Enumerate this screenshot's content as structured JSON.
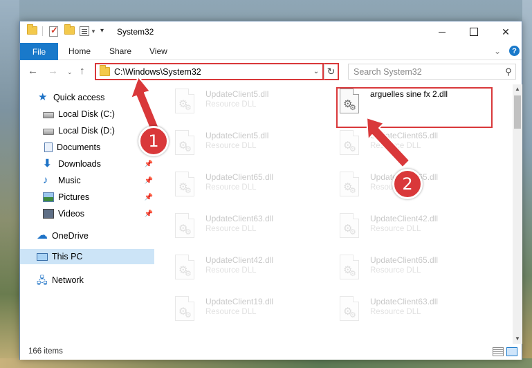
{
  "window": {
    "title": "System32",
    "close_glyph": "✕"
  },
  "ribbon": {
    "tabs": [
      "File",
      "Home",
      "Share",
      "View"
    ],
    "help_glyph": "?"
  },
  "address": {
    "path": "C:\\Windows\\System32",
    "search_placeholder": "Search System32"
  },
  "nav": {
    "items": [
      {
        "label": "Quick access",
        "icon": "star-icon",
        "pinned": false
      },
      {
        "label": "Local Disk (C:)",
        "icon": "disk-icon",
        "pinned": true
      },
      {
        "label": "Local Disk (D:)",
        "icon": "disk-icon",
        "pinned": true
      },
      {
        "label": "Documents",
        "icon": "documents-icon",
        "pinned": true
      },
      {
        "label": "Downloads",
        "icon": "download-icon",
        "pinned": true
      },
      {
        "label": "Music",
        "icon": "music-icon",
        "pinned": true
      },
      {
        "label": "Pictures",
        "icon": "pictures-icon",
        "pinned": true
      },
      {
        "label": "Videos",
        "icon": "videos-icon",
        "pinned": true
      },
      {
        "label": "OneDrive",
        "icon": "cloud-icon",
        "pinned": false
      },
      {
        "label": "This PC",
        "icon": "pc-icon",
        "pinned": false,
        "selected": true
      },
      {
        "label": "Network",
        "icon": "network-icon",
        "pinned": false
      }
    ]
  },
  "files": {
    "highlighted": {
      "name": "arguelles sine fx 2.dll"
    },
    "left_column": [
      {
        "name": "UpdateClient5.dll",
        "type": "Resource DLL"
      },
      {
        "name": "UpdateClient5.dll",
        "type": "Resource DLL"
      },
      {
        "name": "UpdateClient65.dll",
        "type": "Resource DLL"
      },
      {
        "name": "UpdateClient63.dll",
        "type": "Resource DLL"
      },
      {
        "name": "UpdateClient42.dll",
        "type": "Resource DLL"
      },
      {
        "name": "UpdateClient19.dll",
        "type": "Resource DLL"
      }
    ],
    "right_column": [
      {
        "name": "UpdateClient65.dll",
        "type": "Resource DLL"
      },
      {
        "name": "UpdateClient65.dll",
        "type": "Resource DLL"
      },
      {
        "name": "UpdateClient42.dll",
        "type": "Resource DLL"
      },
      {
        "name": "UpdateClient65.dll",
        "type": "Resource DLL"
      },
      {
        "name": "UpdateClient63.dll",
        "type": "Resource DLL"
      }
    ]
  },
  "status": {
    "item_count": "166 items"
  },
  "annotations": {
    "badge1": "1",
    "badge2": "2",
    "accent": "#d9383a"
  }
}
